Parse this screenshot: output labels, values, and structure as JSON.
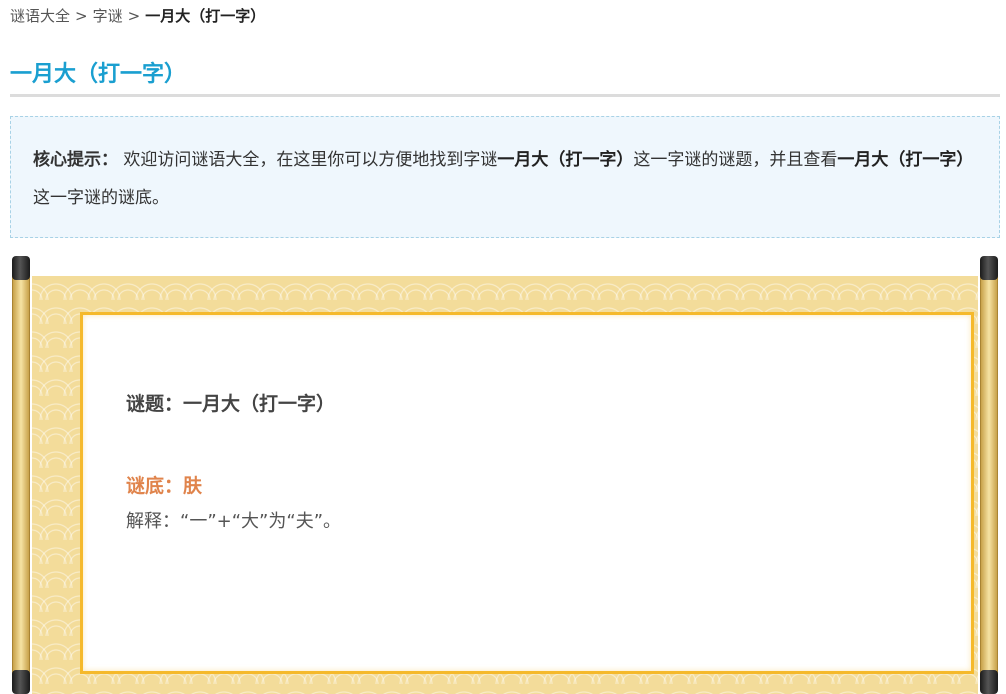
{
  "breadcrumb": {
    "home": "谜语大全",
    "category": "字谜",
    "current": "一月大（打一字）",
    "separator": ">"
  },
  "page_title": "一月大（打一字）",
  "tip": {
    "lead": "核心提示：",
    "part1": "欢迎访问谜语大全，在这里你可以方便地找到字谜",
    "highlight1": "一月大（打一字）",
    "part2": "这一字谜的谜题，并且查看",
    "highlight2": "一月大（打一字）",
    "part3": "这一字谜的谜底。"
  },
  "riddle": {
    "question": "谜题：一月大（打一字）",
    "answer": "谜底：肤",
    "explanation": "解释：“一”+“大”为“夫”。"
  },
  "colors": {
    "title": "#1a9fd0",
    "answer": "#e0844c",
    "frame": "#f5b92b",
    "scroll_paper": "#f3dc9a",
    "tip_bg": "#eff7fd"
  }
}
